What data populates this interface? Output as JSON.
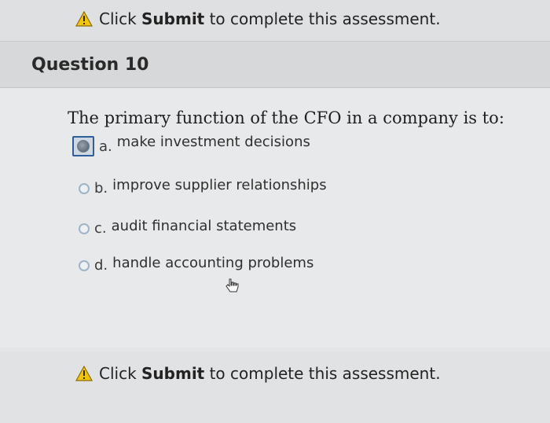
{
  "notice": {
    "prefix": "Click ",
    "bold": "Submit",
    "suffix": " to complete this assessment."
  },
  "question": {
    "title": "Question 10",
    "prompt": "The primary function of the CFO in a company is to:",
    "selected_index": 0,
    "choices": [
      {
        "letter": "a.",
        "text": "make investment decisions"
      },
      {
        "letter": "b.",
        "text": "improve supplier relationships"
      },
      {
        "letter": "c.",
        "text": "audit financial statements"
      },
      {
        "letter": "d.",
        "text": "handle accounting problems"
      }
    ]
  },
  "colors": {
    "warning_yellow": "#f2c40f",
    "selected_border": "#2f5f9a"
  },
  "icons": {
    "warning": "warning-triangle-icon",
    "cursor": "hand-cursor-icon"
  }
}
